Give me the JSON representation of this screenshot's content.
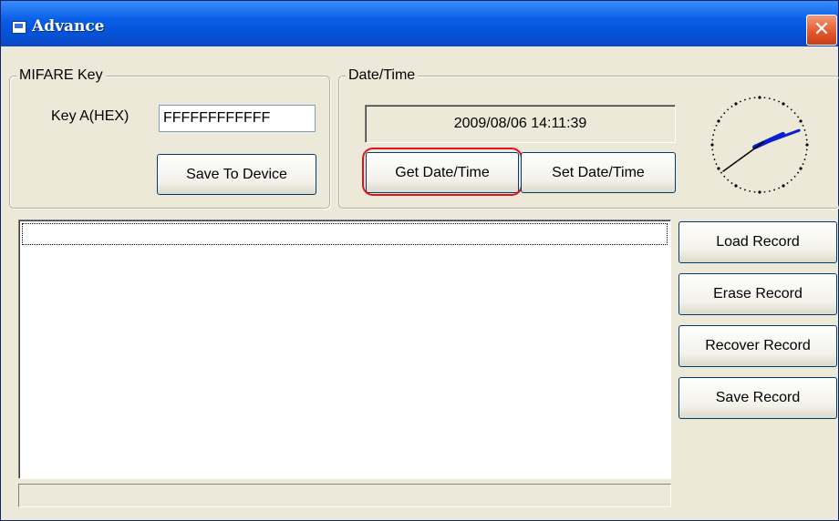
{
  "window": {
    "title": "Advance",
    "close_glyph": "✕"
  },
  "mifare": {
    "group_label": "MIFARE Key",
    "key_label": "Key A(HEX)",
    "key_value": "FFFFFFFFFFFF",
    "save_button": "Save To Device"
  },
  "datetime": {
    "group_label": "Date/Time",
    "value": "2009/08/06 14:11:39",
    "get_button": "Get Date/Time",
    "set_button": "Set Date/Time",
    "clock": {
      "hours": 14,
      "minutes": 11,
      "seconds": 39
    }
  },
  "records": {
    "load_button": "Load Record",
    "erase_button": "Erase Record",
    "recover_button": "Recover Record",
    "save_button": "Save Record",
    "items": []
  },
  "status": {
    "text": ""
  },
  "colors": {
    "titlebar": "#0a5fe8",
    "highlight": "#e4101a",
    "hand": "#0a1fd0"
  }
}
